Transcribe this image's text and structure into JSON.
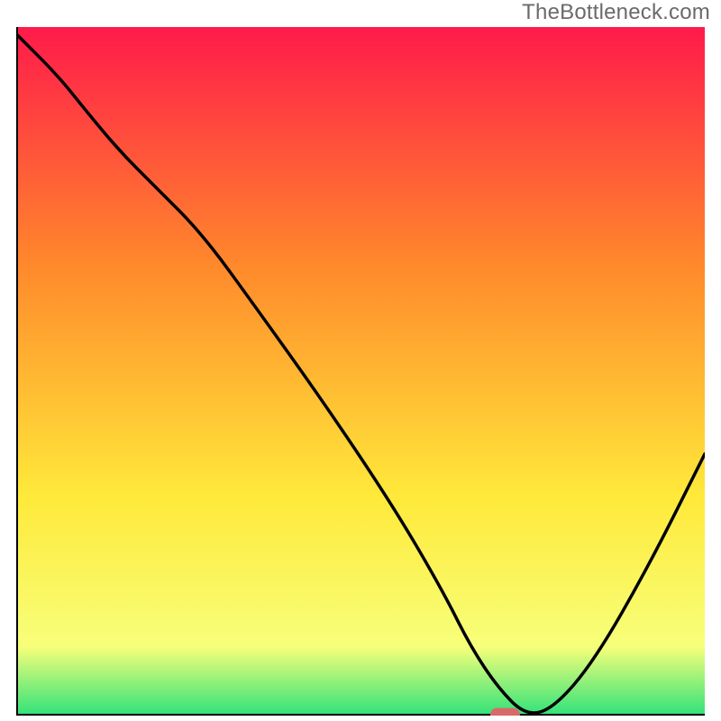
{
  "watermark": "TheBottleneck.com",
  "colors": {
    "top": "#ff1a4b",
    "upper_mid": "#ff8a2b",
    "mid": "#ffe93a",
    "lower_band": "#f7ff7a",
    "bottom": "#2fe27a",
    "curve": "#000000",
    "axis": "#000000",
    "marker_fill": "#d96a6a",
    "marker_stroke": "#d96a6a"
  },
  "chart_data": {
    "type": "line",
    "title": "",
    "xlabel": "",
    "ylabel": "",
    "xlim": [
      0,
      100
    ],
    "ylim": [
      0,
      100
    ],
    "grid": false,
    "legend": null,
    "x": [
      0,
      6,
      10,
      15,
      20,
      27,
      35,
      45,
      55,
      62,
      66,
      70,
      74,
      78,
      84,
      92,
      100
    ],
    "values": [
      99,
      93,
      88,
      82,
      77,
      70,
      59,
      45,
      30,
      18,
      10,
      4,
      0,
      1,
      8,
      22,
      38
    ],
    "marker": {
      "x": 71,
      "y": 0
    }
  }
}
